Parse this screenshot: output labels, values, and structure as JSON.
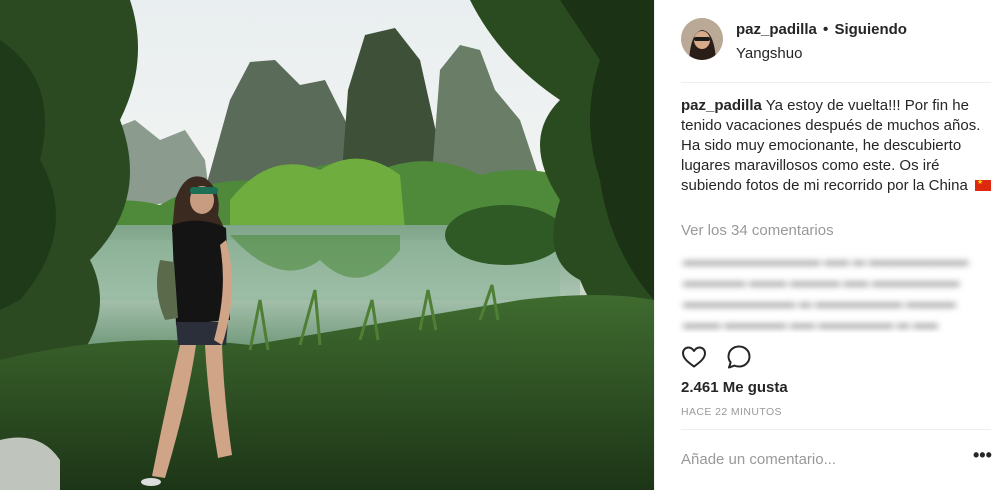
{
  "post": {
    "user": {
      "username": "paz_padilla",
      "separator": "•",
      "follow_status": "Siguiendo",
      "location": "Yangshuo"
    },
    "caption": {
      "username": "paz_padilla",
      "text": "Ya estoy de vuelta!!! Por fin he tenido vacaciones después de muchos años. Ha sido muy emocionante, he descubierto lugares maravillosos como este. Os iré subiendo fotos de mi recorrido por la China",
      "emoji": "china-flag-icon"
    },
    "view_comments_label": "Ver los 34 comentarios",
    "likes_label": "2.461 Me gusta",
    "time_label": "HACE 22 MINUTOS",
    "comment_placeholder": "Añade un comentario...",
    "more_label": "•••",
    "icons": {
      "like": "heart-icon",
      "comment": "comment-bubble-icon",
      "more": "more-options-icon"
    }
  }
}
